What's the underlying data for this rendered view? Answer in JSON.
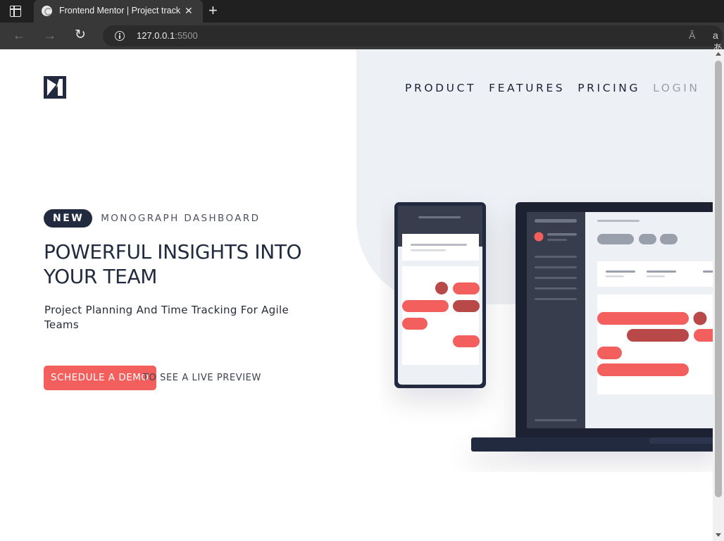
{
  "browser": {
    "tab_title": "Frontend Mentor | Project tracking intro component",
    "tab_close": "✕",
    "new_tab": "+",
    "url_host": "127.0.0.1",
    "url_port": ":5500",
    "nav_back": "←",
    "nav_forward": "→",
    "nav_reload": "↻",
    "read_aloud": "Ă",
    "translate": "aあ"
  },
  "page": {
    "nav": {
      "product": "PRODUCT",
      "features": "FEATURES",
      "pricing": "PRICING",
      "login": "LOGIN"
    },
    "hero": {
      "badge": "NEW",
      "badge_text": "MONOGRAPH DASHBOARD",
      "headline": "POWERFUL INSIGHTS INTO YOUR TEAM",
      "subtitle": "Project Planning And Time Tracking For Agile Teams",
      "cta": "SCHEDULE A DEMO",
      "cta_note": "TO SEE A LIVE PREVIEW"
    },
    "colors": {
      "accent": "#f25f5c",
      "dark": "#222a3f",
      "panel": "#edf0f4"
    }
  }
}
